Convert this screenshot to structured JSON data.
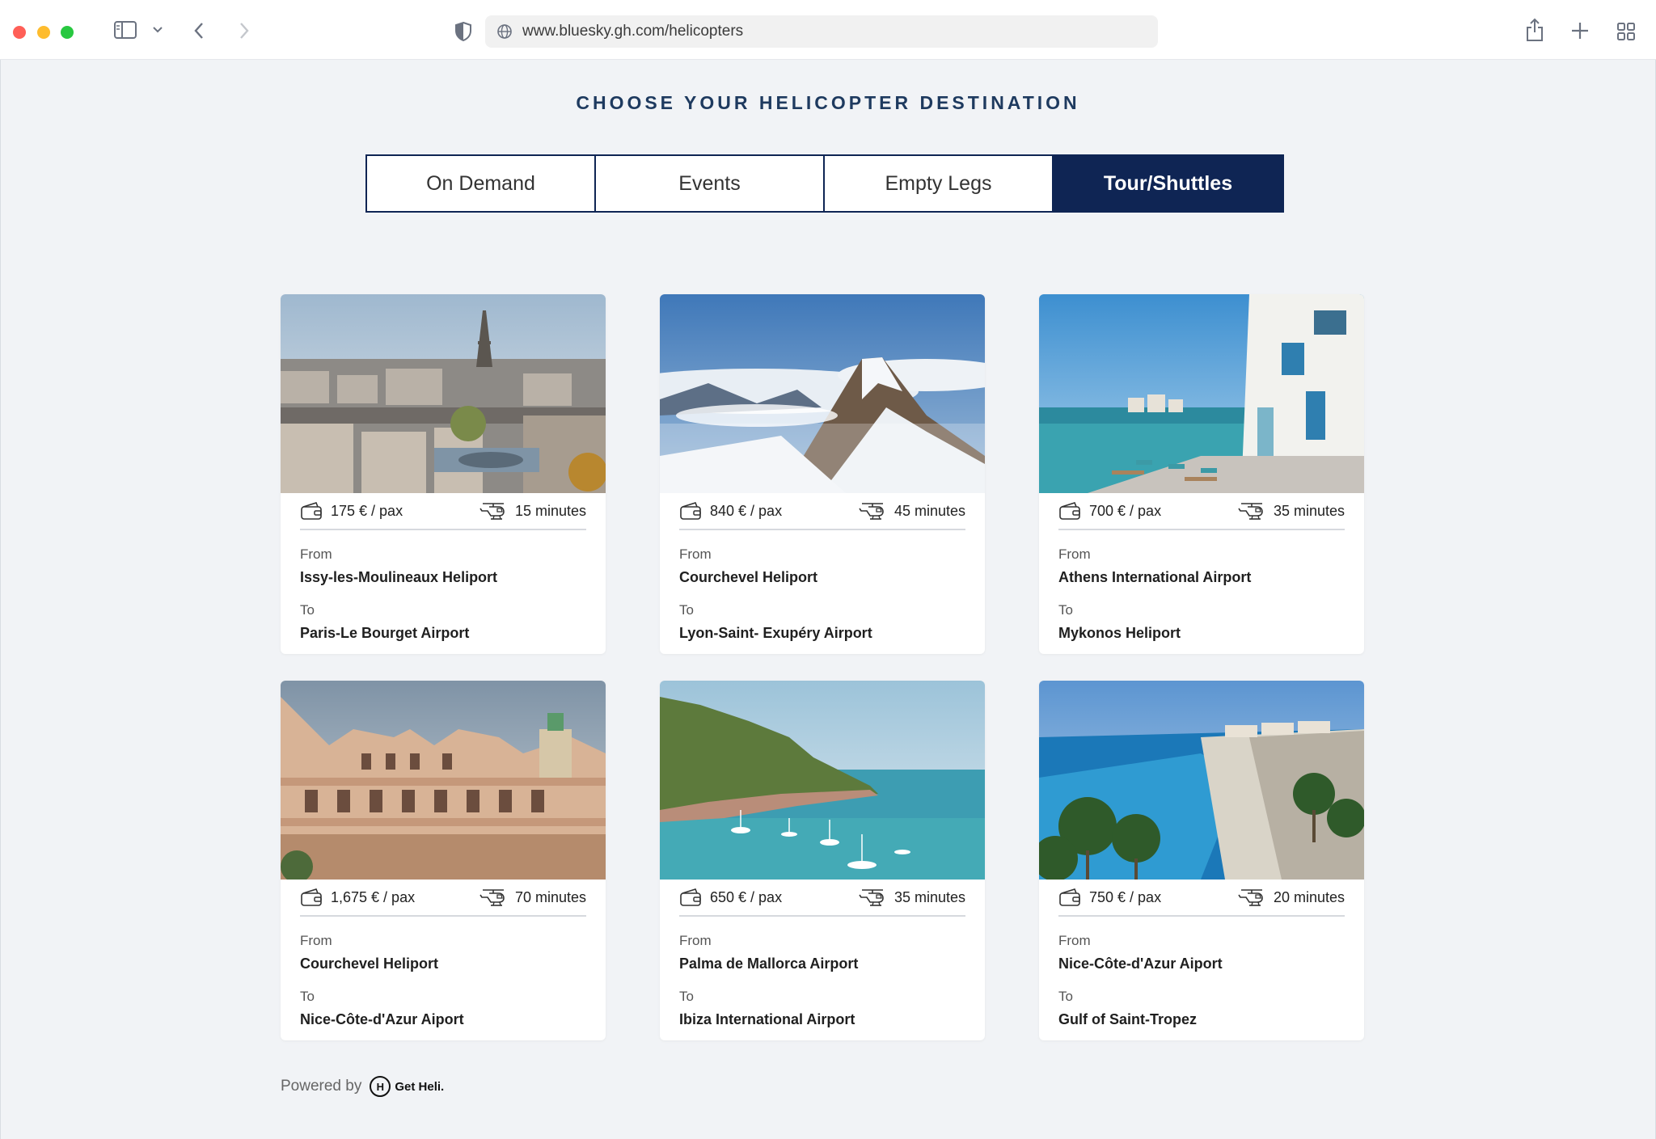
{
  "browser": {
    "url": "www.bluesky.gh.com/helicopters"
  },
  "page": {
    "title": "CHOOSE YOUR HELICOPTER DESTINATION",
    "tabs": [
      {
        "label": "On Demand",
        "active": false
      },
      {
        "label": "Events",
        "active": false
      },
      {
        "label": "Empty Legs",
        "active": false
      },
      {
        "label": "Tour/Shuttles",
        "active": true
      }
    ],
    "from_label": "From",
    "to_label": "To",
    "cards": [
      {
        "price": "175 € / pax",
        "duration": "15 minutes",
        "from": "Issy-les-Moulineaux Heliport",
        "to": "Paris-Le Bourget Airport",
        "image": "paris-eiffel-tower"
      },
      {
        "price": "840 € / pax",
        "duration": "45 minutes",
        "from": "Courchevel Heliport",
        "to": "Lyon-Saint- Exupéry Airport",
        "image": "snowy-mountain-peak"
      },
      {
        "price": "700 € / pax",
        "duration": "35 minutes",
        "from": "Athens International Airport",
        "to": "Mykonos Heliport",
        "image": "greek-seaside-terrace"
      },
      {
        "price": "1,675  € / pax",
        "duration": "70 minutes",
        "from": "Courchevel Heliport",
        "to": "Nice-Côte-d'Azur Aiport",
        "image": "monaco-palace-building"
      },
      {
        "price": "650 € / pax",
        "duration": "35 minutes",
        "from": "Palma de Mallorca Airport",
        "to": "Ibiza International Airport",
        "image": "mallorca-bay-boats"
      },
      {
        "price": "750 € / pax",
        "duration": "20 minutes",
        "from": "Nice-Côte-d'Azur Aiport",
        "to": "Gulf of Saint-Tropez",
        "image": "nice-beach-promenade"
      }
    ],
    "footer": {
      "powered_by": "Powered by",
      "brand_mark": "H",
      "brand": "Get Heli."
    }
  },
  "colors": {
    "navy": "#0f2554",
    "title": "#1e3a5f",
    "background": "#f1f3f6"
  }
}
